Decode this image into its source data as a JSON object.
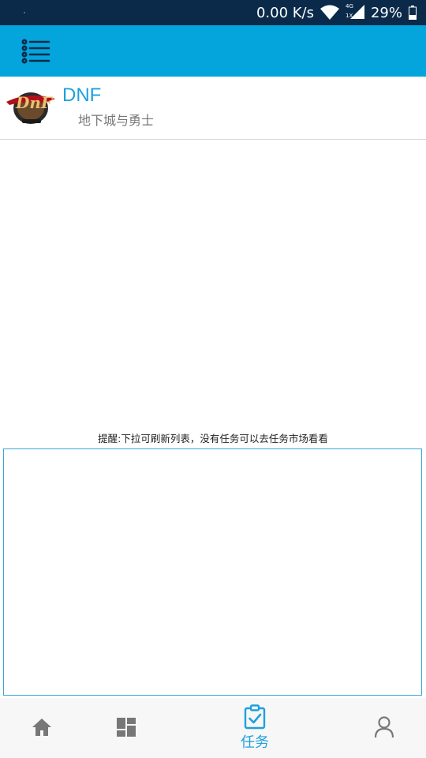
{
  "status_bar": {
    "network_speed": "0.00 K/s",
    "network_type": "4G",
    "sim_slot": "1X",
    "battery": "29%"
  },
  "app_bar": {
    "menu_icon": "list-menu-icon",
    "color": "#03a5dc"
  },
  "game": {
    "logo_text": "DnF",
    "name": "DNF",
    "subtitle": "地下城与勇士"
  },
  "task_list": {
    "reminder": "提醒:下拉可刷新列表，没有任务可以去任务市场看看"
  },
  "bottom_nav": {
    "items": [
      {
        "icon": "home-icon",
        "label": ""
      },
      {
        "icon": "dashboard-icon",
        "label": ""
      },
      {
        "icon": "clipboard-check-icon",
        "label": "任务",
        "active": true
      },
      {
        "icon": "user-icon",
        "label": ""
      }
    ],
    "active_color": "#1ea0dc",
    "inactive_color": "#777777"
  }
}
